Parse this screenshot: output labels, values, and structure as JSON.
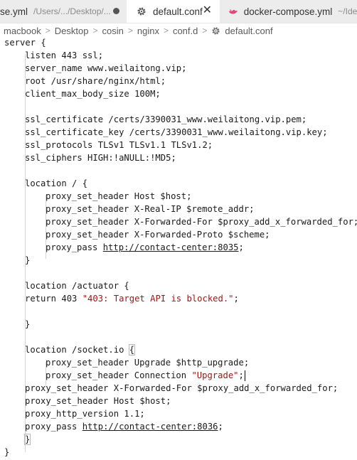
{
  "tabs": [
    {
      "name": "se.yml",
      "path": "/Users/.../Desktop/...",
      "dirty": true
    },
    {
      "name": "default.conf",
      "active": true
    },
    {
      "name": "docker-compose.yml",
      "path": "~/Idea"
    }
  ],
  "breadcrumb": [
    "macbook",
    "Desktop",
    "cosin",
    "nginx",
    "conf.d",
    "default.conf"
  ],
  "code": {
    "l1": "server {",
    "l2": "listen 443 ssl;",
    "l3": "server_name www.weilaitong.vip;",
    "l4": "root /usr/share/nginx/html;",
    "l5": "client_max_body_size 100M;",
    "l7": "ssl_certificate /certs/3390031_www.weilaitong.vip.pem;",
    "l8": "ssl_certificate_key /certs/3390031_www.weilaitong.vip.key;",
    "l9": "ssl_protocols TLSv1 TLSv1.1 TLSv1.2;",
    "l10": "ssl_ciphers HIGH:!aNULL:!MD5;",
    "l12": "location / {",
    "l13": "proxy_set_header Host $host;",
    "l14": "proxy_set_header X-Real-IP $remote_addr;",
    "l15": "proxy_set_header X-Forwarded-For $proxy_add_x_forwarded_for;",
    "l16": "proxy_set_header X-Forwarded-Proto $scheme;",
    "l17_prefix": "proxy_pass ",
    "l17_url": "http://contact-center:8035",
    "l17_suffix": ";",
    "l18": "}",
    "l20": "location /actuator {",
    "l21_prefix": "return 403 ",
    "l21_str": "\"403: Target API is blocked.\"",
    "l21_suffix": ";",
    "l23": "}",
    "l25_prefix": "location /socket.io ",
    "l25_brace": "{",
    "l26": "proxy_set_header Upgrade $http_upgrade;",
    "l27_prefix": "proxy_set_header Connection ",
    "l27_str": "\"Upgrade\"",
    "l27_suffix": ";",
    "l28": "proxy_set_header X-Forwarded-For $proxy_add_x_forwarded_for;",
    "l29": "proxy_set_header Host $host;",
    "l30": "proxy_http_version 1.1;",
    "l31_prefix": "proxy_pass ",
    "l31_url": "http://contact-center:8036",
    "l31_suffix": ";",
    "l32": "}",
    "l33": "}"
  }
}
